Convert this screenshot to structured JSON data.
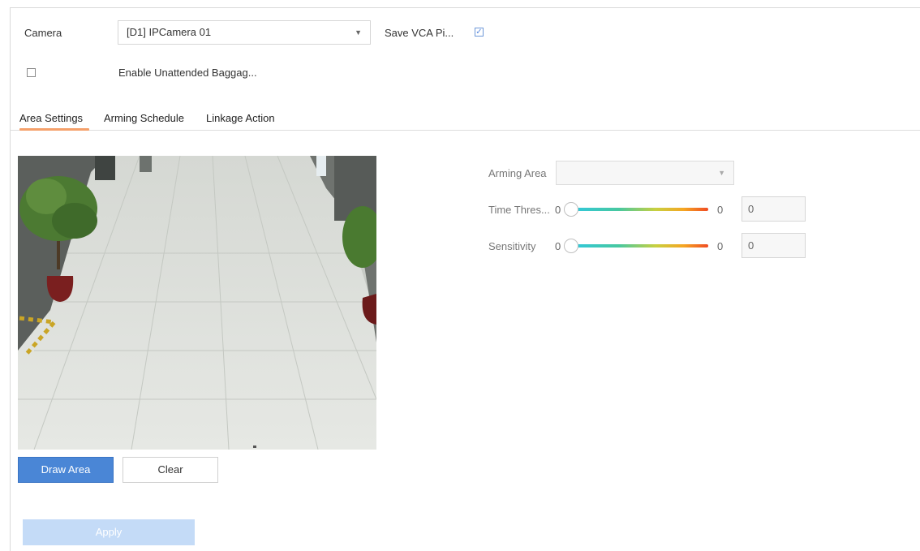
{
  "camera": {
    "label": "Camera",
    "selected": "[D1] IPCamera 01",
    "save_vca_label": "Save VCA Pi...",
    "save_vca_checked": true
  },
  "enable": {
    "label": "Enable Unattended Baggag...",
    "checked": false
  },
  "tabs": [
    {
      "label": "Area Settings",
      "active": true
    },
    {
      "label": "Arming Schedule",
      "active": false
    },
    {
      "label": "Linkage Action",
      "active": false
    }
  ],
  "video_buttons": {
    "draw_area": "Draw Area",
    "clear": "Clear"
  },
  "settings": {
    "arming_area_label": "Arming Area",
    "arming_area_value": "",
    "time_threshold": {
      "label": "Time Thres...",
      "min_text": "0",
      "max_text": "0",
      "value": "0",
      "level": 0
    },
    "sensitivity": {
      "label": "Sensitivity",
      "min_text": "0",
      "max_text": "0",
      "value": "0",
      "level": 0
    }
  },
  "apply_label": "Apply"
}
